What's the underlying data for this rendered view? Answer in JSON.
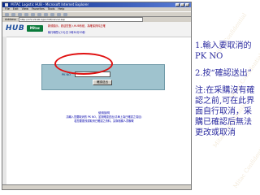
{
  "watermark": {
    "text": "Mitac Confidential"
  },
  "window": {
    "title": "MiTAC Logistic HUB - Microsoft Internet Explorer",
    "menu": [
      "File",
      "Edit",
      "View",
      "Favorites",
      "Tools",
      "Help"
    ],
    "address_label": "Address",
    "address": "http://172.20.90.1/picmtt/cancel.asp"
  },
  "page": {
    "logo_text": "HUB",
    "brand_text": "Mitac",
    "banner_note": "新德顯示，歡迎您登入HUB系統，為確保資料正確",
    "banner_note2": "執行時間:{13}日 2時30分53秒",
    "form_label": "PK NO",
    "confirm_button": "確認送出",
    "note_title": "使用說明",
    "note_lines": [
      "請輸入您要取消的 PK NO，並按確認送出(清單上為已確認之項目)",
      "若您要更改或取消已確認之資料，請與相關人員聯繫"
    ]
  },
  "instructions": {
    "step1": "1.輸入要取消的PK NO",
    "step2": "2.按“確認送出”",
    "note": "注:在采購沒有確認之前,可在此界面自行取消，采購已確認后無法更改或取消"
  },
  "colors": {
    "instruction_text": "#2b2ba0",
    "panel_bg": "#9fc3ce",
    "highlight": "#e01010",
    "brand_green": "#0a7a3a"
  }
}
